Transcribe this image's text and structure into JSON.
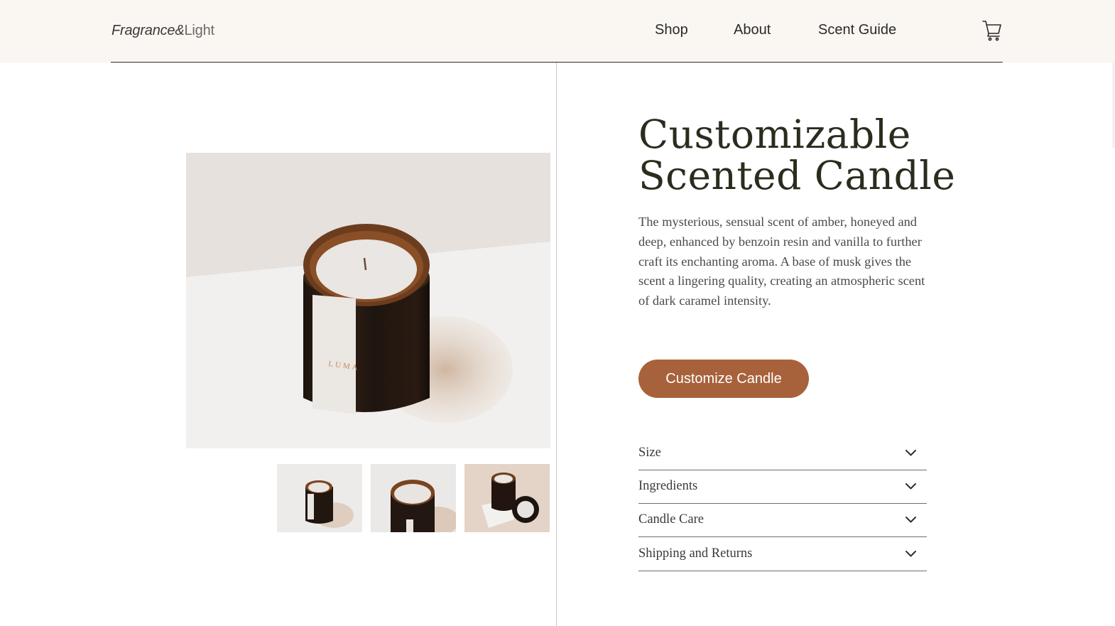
{
  "header": {
    "logo_part1": "Fragrance&",
    "logo_part2": "Light",
    "nav": [
      {
        "label": "Shop"
      },
      {
        "label": "About"
      },
      {
        "label": "Scent Guide"
      }
    ],
    "cart_icon": "cart-icon"
  },
  "product": {
    "title_line1": "Customizable",
    "title_line2": "Scented Candle",
    "description": "The mysterious, sensual scent of amber, honeyed and deep, enhanced by benzoin resin and vanilla to further craft its enchanting aroma. A base of musk gives the scent a lingering quality, creating an atmospheric scent of dark caramel intensity.",
    "cta_label": "Customize Candle",
    "label_text": "LUMA"
  },
  "accordion": [
    {
      "label": "Size"
    },
    {
      "label": "Ingredients"
    },
    {
      "label": "Candle Care"
    },
    {
      "label": "Shipping and Returns"
    }
  ],
  "colors": {
    "header_bg": "#faf6f1",
    "accent": "#a8623b",
    "title": "#2a2d1d"
  }
}
